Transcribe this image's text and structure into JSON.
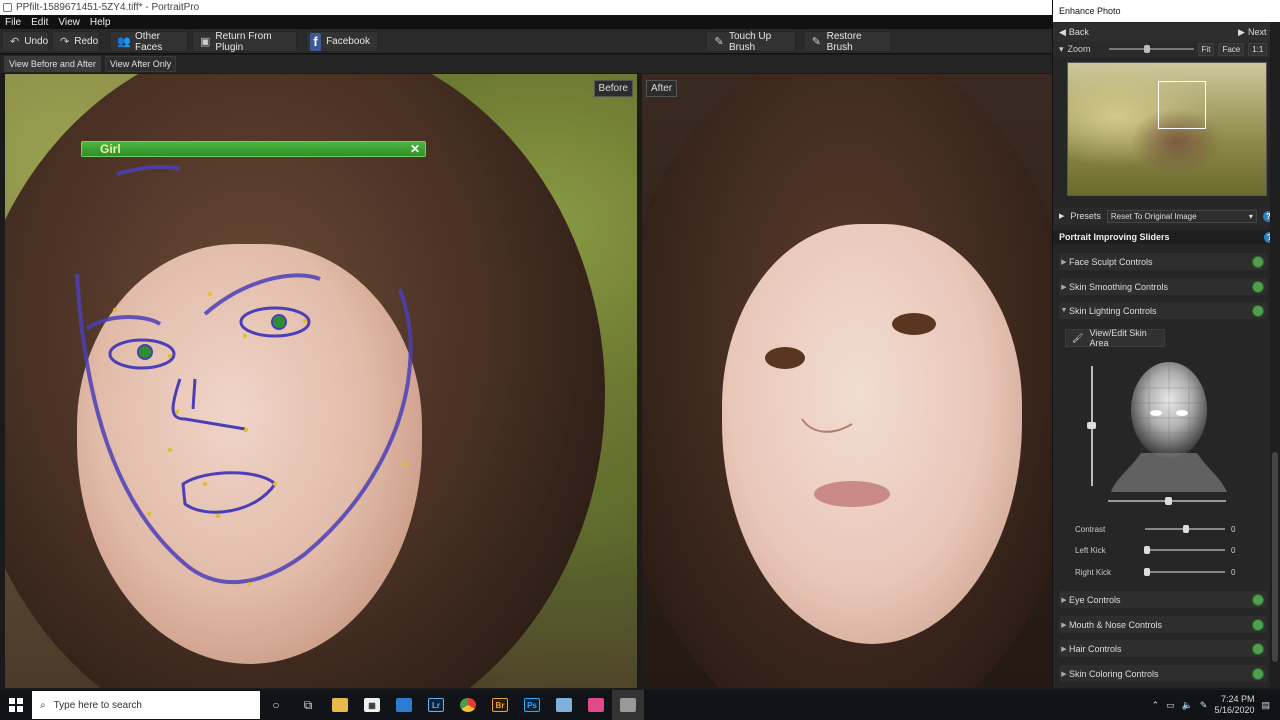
{
  "window": {
    "title": "PPfilt-1589671451-5ZY4.tiff* - PortraitPro"
  },
  "menu": [
    "File",
    "Edit",
    "View",
    "Help"
  ],
  "toolbar": {
    "undo": "Undo",
    "redo": "Redo",
    "other_faces": "Other Faces",
    "return_plugin": "Return From Plugin",
    "facebook": "Facebook",
    "touch_up": "Touch Up Brush",
    "restore": "Restore Brush"
  },
  "view_tabs": {
    "before_after": "View Before and After",
    "after_only": "View After Only"
  },
  "before_label": "Before",
  "after_label": "After",
  "face_tag": "Girl",
  "panel": {
    "title": "Enhance Photo",
    "back": "Back",
    "next": "Next",
    "zoom": "Zoom",
    "fit": "Fit",
    "face": "Face",
    "one_to_one": "1:1",
    "presets": "Presets",
    "preset_value": "Reset To Original Image",
    "sliders_header": "Portrait Improving Sliders",
    "sections": {
      "face_sculpt": "Face Sculpt Controls",
      "skin_smoothing": "Skin Smoothing Controls",
      "skin_lighting": "Skin Lighting Controls",
      "eye": "Eye Controls",
      "mouth_nose": "Mouth & Nose Controls",
      "hair": "Hair Controls",
      "skin_coloring": "Skin Coloring Controls"
    },
    "view_edit_skin": "View/Edit Skin Area",
    "contrast": {
      "label": "Contrast",
      "value": "0"
    },
    "left_kick": {
      "label": "Left Kick",
      "value": "0"
    },
    "right_kick": {
      "label": "Right Kick",
      "value": "0"
    }
  },
  "taskbar": {
    "search_placeholder": "Type here to search",
    "time": "7:24 PM",
    "date": "5/16/2020"
  },
  "colors": {
    "accent_green": "#3aa832",
    "help_blue": "#2c7fbf",
    "facebook": "#3b5998"
  }
}
